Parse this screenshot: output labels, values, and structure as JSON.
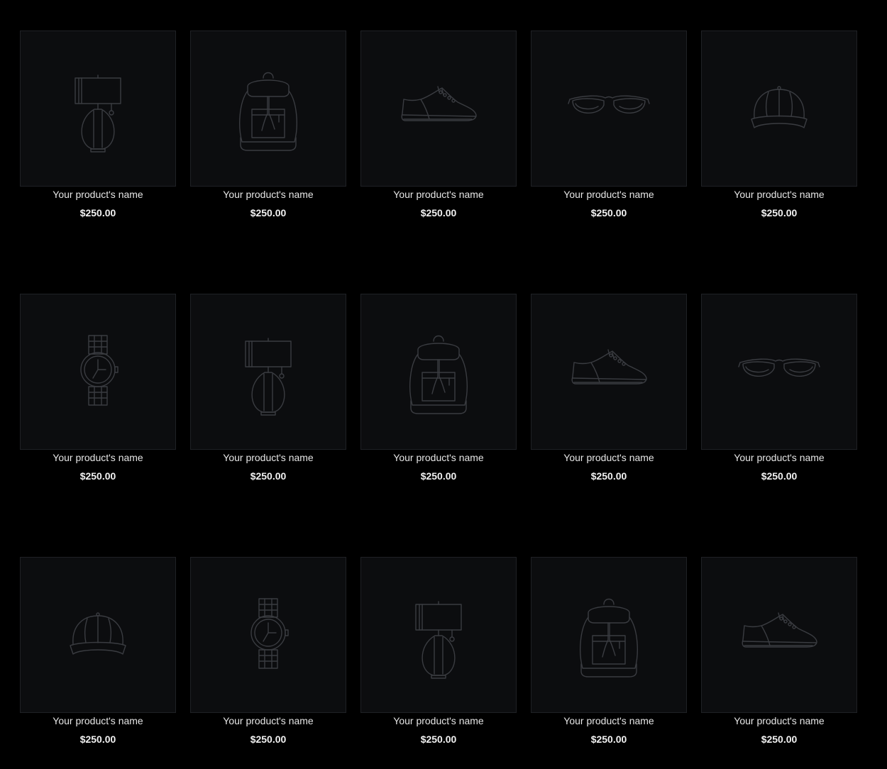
{
  "products": [
    {
      "name": "Your product's name",
      "price": "$250.00",
      "icon": "lamp-icon"
    },
    {
      "name": "Your product's name",
      "price": "$250.00",
      "icon": "backpack-icon"
    },
    {
      "name": "Your product's name",
      "price": "$250.00",
      "icon": "sneaker-icon"
    },
    {
      "name": "Your product's name",
      "price": "$250.00",
      "icon": "sunglasses-icon"
    },
    {
      "name": "Your product's name",
      "price": "$250.00",
      "icon": "cap-icon"
    },
    {
      "name": "Your product's name",
      "price": "$250.00",
      "icon": "watch-icon"
    },
    {
      "name": "Your product's name",
      "price": "$250.00",
      "icon": "lamp-icon"
    },
    {
      "name": "Your product's name",
      "price": "$250.00",
      "icon": "backpack-icon"
    },
    {
      "name": "Your product's name",
      "price": "$250.00",
      "icon": "sneaker-icon"
    },
    {
      "name": "Your product's name",
      "price": "$250.00",
      "icon": "sunglasses-icon"
    },
    {
      "name": "Your product's name",
      "price": "$250.00",
      "icon": "cap-icon"
    },
    {
      "name": "Your product's name",
      "price": "$250.00",
      "icon": "watch-icon"
    },
    {
      "name": "Your product's name",
      "price": "$250.00",
      "icon": "lamp-icon"
    },
    {
      "name": "Your product's name",
      "price": "$250.00",
      "icon": "backpack-icon"
    },
    {
      "name": "Your product's name",
      "price": "$250.00",
      "icon": "sneaker-icon"
    }
  ]
}
